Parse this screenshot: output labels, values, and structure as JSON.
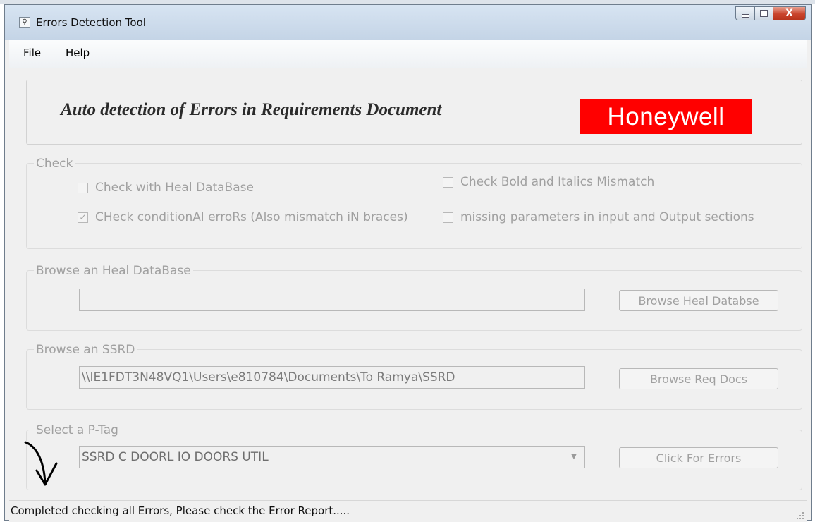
{
  "window": {
    "title": "Errors Detection Tool",
    "close_glyph": "X"
  },
  "menu": {
    "file": "File",
    "help": "Help"
  },
  "header": {
    "title": "Auto detection of Errors in Requirements Document",
    "logo_text": "Honeywell",
    "logo_color": "#ff0000"
  },
  "check": {
    "legend": "Check",
    "heal_db": {
      "label": "Check with Heal DataBase",
      "checked": false
    },
    "bold_italics": {
      "label": "Check Bold and Italics Mismatch",
      "checked": false
    },
    "conditional": {
      "label": "CHeck conditionAl erroRs (Also mismatch iN braces)",
      "checked": true
    },
    "missing_params": {
      "label": "missing parameters in input and Output sections",
      "checked": false
    }
  },
  "heal_db_group": {
    "legend": "Browse an Heal DataBase",
    "path_value": "",
    "button_label": "Browse Heal Databse"
  },
  "ssrd_group": {
    "legend": "Browse an SSRD",
    "path_value": "\\\\IE1FDT3N48VQ1\\Users\\e810784\\Documents\\To Ramya\\SSRD",
    "button_label": "Browse Req Docs"
  },
  "ptag_group": {
    "legend": "Select a P-Tag",
    "selected_value": "SSRD C DOORL IO DOORS UTIL",
    "button_label": "Click For Errors"
  },
  "status": {
    "text": "Completed checking all Errors, Please check the Error Report....."
  }
}
